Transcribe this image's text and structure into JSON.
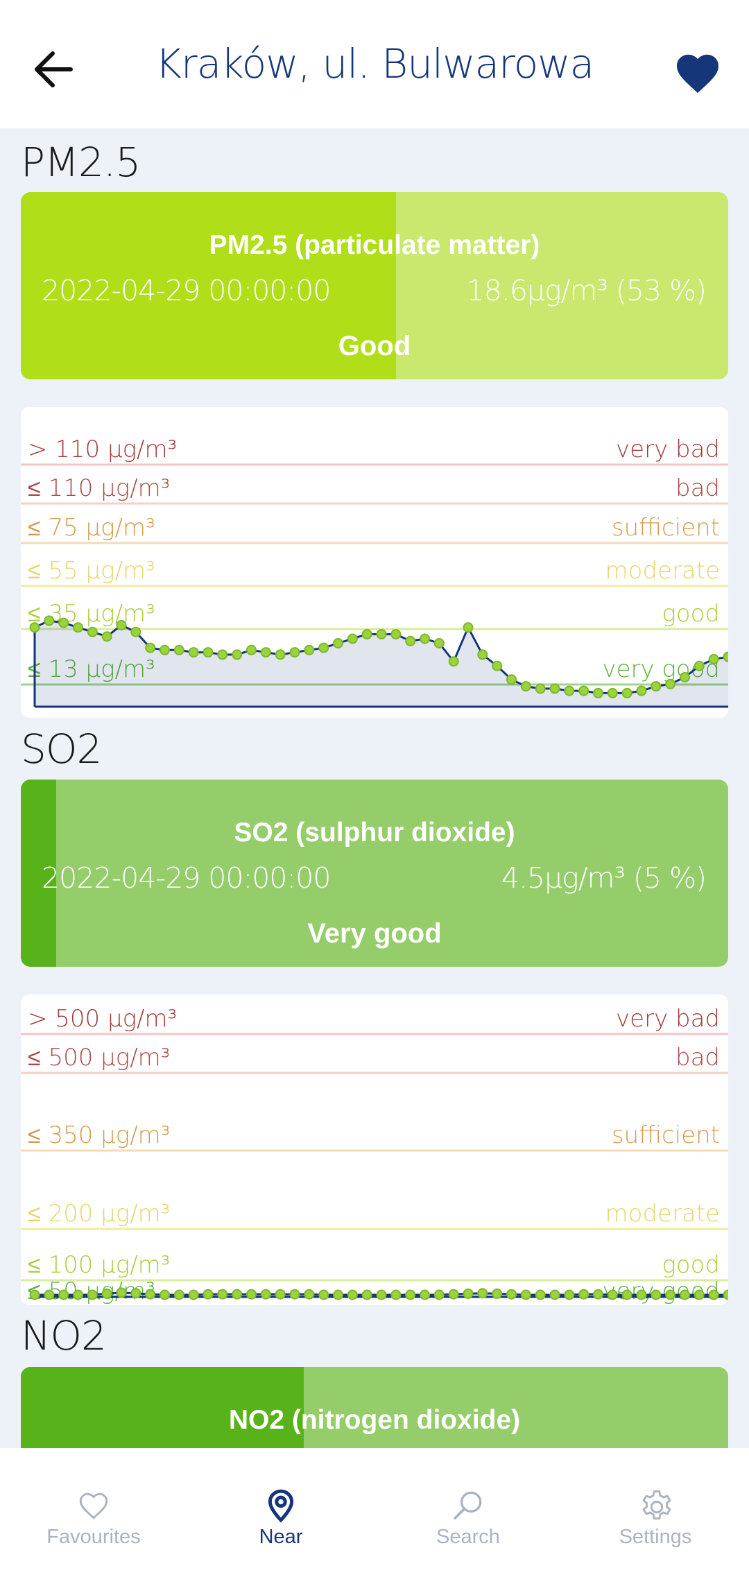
{
  "header": {
    "title": "Kraków, ul. Bulwarowa",
    "back_icon": "arrow-left-icon",
    "favourite_icon": "heart-filled-icon"
  },
  "colors": {
    "primary": "#16367a",
    "very_bad": "#a33a3a",
    "bad": "#b04848",
    "sufficient": "#d49a4a",
    "moderate": "#e6d46a",
    "good": "#a8cf3c",
    "very_good": "#5ab13c"
  },
  "sections": [
    {
      "heading": "PM2.5",
      "card": {
        "title": "PM2.5 (particulate matter)",
        "date": "2022-04-29 00:00:00",
        "value": "18.6µg/m³ (53 %)",
        "status": "Good",
        "percent": 53,
        "fill_color": "#b0de19",
        "bg_color": "#cbe86e"
      },
      "chart": {
        "thresholds": [
          {
            "left": "> 110 µg/m³",
            "right": "very bad",
            "color": "#a33a3a",
            "line": "#f2c6c6"
          },
          {
            "left": "≤ 110 µg/m³",
            "right": "bad",
            "color": "#b04848",
            "line": "#f4d0c8"
          },
          {
            "left": "≤ 75 µg/m³",
            "right": "sufficient",
            "color": "#d49a4a",
            "line": "#f6d9b5"
          },
          {
            "left": "≤ 55 µg/m³",
            "right": "moderate",
            "color": "#e6d46a",
            "line": "#f3ea9e"
          },
          {
            "left": "≤ 35 µg/m³",
            "right": "good",
            "color": "#a8cf3c",
            "line": "#d8ec9a"
          },
          {
            "left": "≤ 13 µg/m³",
            "right": "very good",
            "color": "#5ab13c",
            "line": "#9fd58a"
          }
        ]
      }
    },
    {
      "heading": "SO2",
      "card": {
        "title": "SO2 (sulphur dioxide)",
        "date": "2022-04-29 00:00:00",
        "value": "4.5µg/m³ (5 %)",
        "status": "Very good",
        "percent": 5,
        "fill_color": "#58b31a",
        "bg_color": "#96cd6b"
      },
      "chart": {
        "thresholds": [
          {
            "left": "> 500 µg/m³",
            "right": "very bad",
            "color": "#a33a3a",
            "line": "#f2c6c6"
          },
          {
            "left": "≤ 500 µg/m³",
            "right": "bad",
            "color": "#b04848",
            "line": "#f4d0c8"
          },
          {
            "left": "≤ 350 µg/m³",
            "right": "sufficient",
            "color": "#d49a4a",
            "line": "#f6d9b5"
          },
          {
            "left": "≤ 200 µg/m³",
            "right": "moderate",
            "color": "#e6d46a",
            "line": "#f3ea9e"
          },
          {
            "left": "≤ 100 µg/m³",
            "right": "good",
            "color": "#a8cf3c",
            "line": "#d8ec9a"
          },
          {
            "left": "≤ 50 µg/m³",
            "right": "very good",
            "color": "#5ab13c",
            "line": "#9fd58a"
          }
        ]
      }
    },
    {
      "heading": "NO2",
      "card": {
        "title": "NO2 (nitrogen dioxide)",
        "percent": 40,
        "fill_color": "#58b31a",
        "bg_color": "#96cd6b"
      }
    }
  ],
  "chart_data": [
    {
      "type": "area",
      "ylim": [
        0,
        120
      ],
      "series": [
        {
          "values": [
            35,
            38,
            37,
            35,
            33,
            31,
            36,
            33,
            26,
            25,
            25,
            24,
            24,
            23,
            23,
            25,
            24,
            23,
            24,
            25,
            26,
            28,
            30,
            32,
            32,
            32,
            29,
            30,
            28,
            20,
            35,
            23,
            18,
            12,
            9,
            8,
            8,
            7,
            7,
            6,
            6,
            6,
            7,
            9,
            10,
            13,
            18,
            21,
            22
          ]
        }
      ]
    },
    {
      "type": "area",
      "ylim": [
        0,
        520
      ],
      "series": [
        {
          "values": [
            4,
            4,
            4,
            4,
            4,
            6,
            8,
            7,
            5,
            4,
            4,
            4,
            5,
            5,
            5,
            5,
            5,
            5,
            5,
            5,
            4,
            4,
            4,
            4,
            4,
            4,
            4,
            4,
            4,
            5,
            6,
            7,
            6,
            5,
            4,
            4,
            4,
            4,
            5,
            5,
            4,
            4,
            4,
            4,
            4,
            4,
            4,
            4,
            4
          ]
        }
      ]
    }
  ],
  "nav": [
    {
      "label": "Favourites",
      "icon": "heart-outline-icon",
      "active": false
    },
    {
      "label": "Near",
      "icon": "location-pin-icon",
      "active": true
    },
    {
      "label": "Search",
      "icon": "search-icon",
      "active": false
    },
    {
      "label": "Settings",
      "icon": "gear-icon",
      "active": false
    }
  ]
}
